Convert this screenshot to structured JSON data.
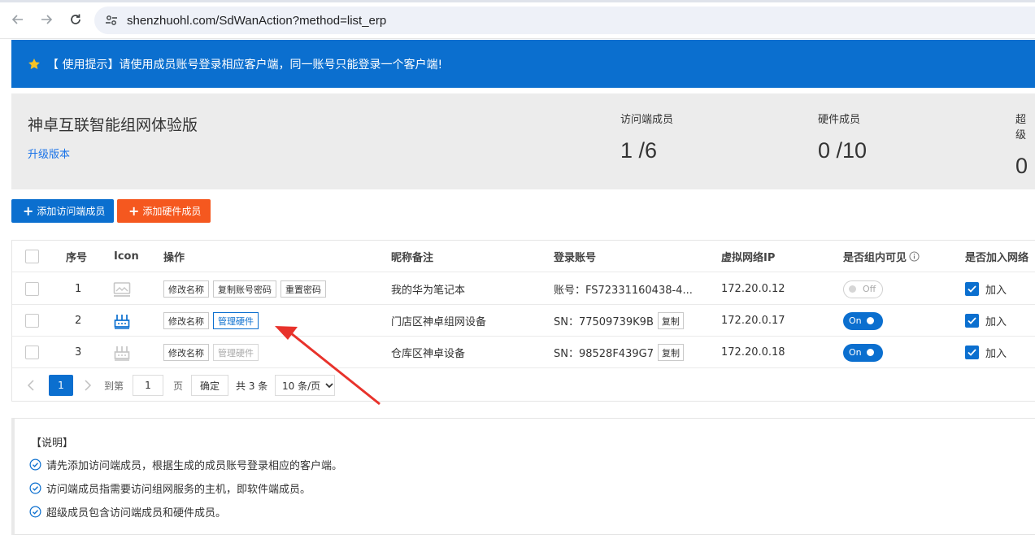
{
  "browser": {
    "url": "shenzhuohl.com/SdWanAction?method=list_erp"
  },
  "notice": {
    "text": "【 使用提示】请使用成员账号登录相应客户端，同一账号只能登录一个客户端!"
  },
  "summary": {
    "plan_title": "神卓互联智能组网体验版",
    "upgrade_label": "升级版本",
    "stats": [
      {
        "label": "访问端成员",
        "value": "1 /6"
      },
      {
        "label": "硬件成员",
        "value": "0 /10"
      },
      {
        "label": "超级",
        "value": "0"
      }
    ]
  },
  "actions": {
    "add_access": "添加访问端成员",
    "add_hardware": "添加硬件成员"
  },
  "table": {
    "headers": {
      "index": "序号",
      "icon": "Icon",
      "ops": "操作",
      "nickname": "昵称备注",
      "account": "登录账号",
      "vip": "虚拟网络IP",
      "visible": "是否组内可见",
      "join": "是否加入网络"
    },
    "rows": [
      {
        "index": "1",
        "icon": "monitor-icon",
        "ops": [
          "修改名称",
          "复制账号密码",
          "重置密码"
        ],
        "nickname": "我的华为笔记本",
        "account": "账号：FS72331160438-4...",
        "copy": "",
        "ip": "172.20.0.12",
        "visible": "Off",
        "join": "加入"
      },
      {
        "index": "2",
        "icon": "router-icon",
        "ops": [
          "修改名称",
          "管理硬件"
        ],
        "nickname": "门店区神卓组网设备",
        "account": "SN：77509739K9B",
        "copy": "复制",
        "ip": "172.20.0.17",
        "visible": "On",
        "join": "加入"
      },
      {
        "index": "3",
        "icon": "router-icon",
        "ops": [
          "修改名称",
          "管理硬件"
        ],
        "nickname": "仓库区神卓设备",
        "account": "SN：98528F439G7",
        "copy": "复制",
        "ip": "172.20.0.18",
        "visible": "On",
        "join": "加入"
      }
    ]
  },
  "pagination": {
    "current": "1",
    "goto_label": "到第",
    "goto_value": "1",
    "page_suffix": "页",
    "confirm": "确定",
    "total": "共 3 条",
    "page_size": "10 条/页"
  },
  "info": {
    "title": "【说明】",
    "items": [
      "请先添加访问端成员，根据生成的成员账号登录相应的客户端。",
      "访问端成员指需要访问组网服务的主机，即软件端成员。",
      "超级成员包含访问端成员和硬件成员。"
    ]
  },
  "colors": {
    "primary": "#0b6fcf",
    "orange": "#f5581f",
    "annotation_arrow": "#e8322b"
  }
}
